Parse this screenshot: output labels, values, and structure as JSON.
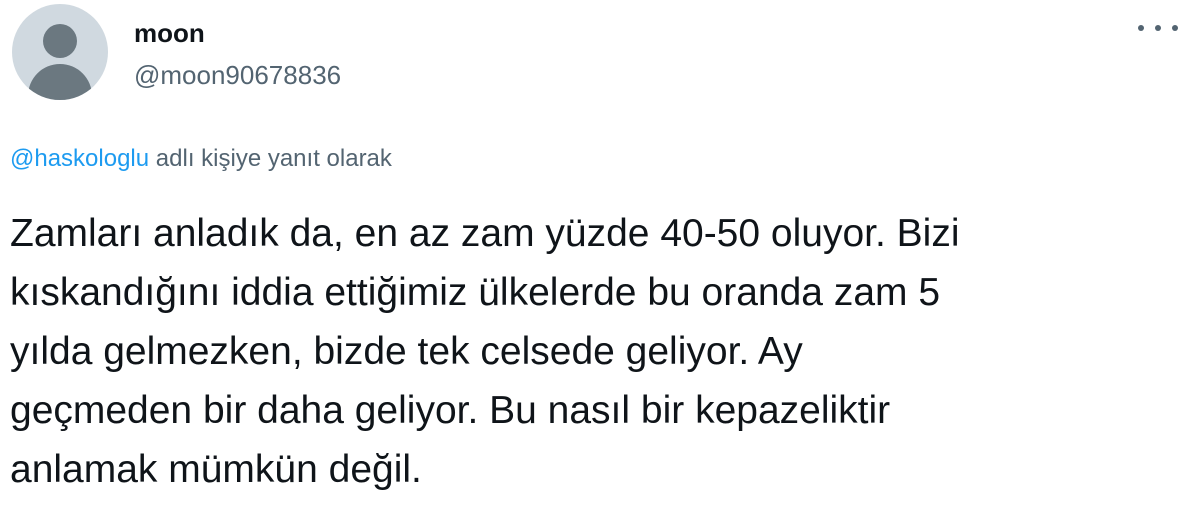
{
  "user": {
    "display_name": "moon",
    "handle": "@moon90678836",
    "avatar_icon": "default-profile-icon"
  },
  "reply": {
    "mention": "@haskologlu",
    "suffix": " adlı kişiye yanıt olarak"
  },
  "tweet": {
    "text_lines": [
      "Zamları anladık da, en az zam yüzde 40-50 oluyor. Bizi",
      "kıskandığını iddia ettiğimiz ülkelerde bu oranda zam 5",
      "yılda gelmezken, bizde tek celsede geliyor. Ay",
      "geçmeden bir daha geliyor. Bu nasıl bir kepazeliktir",
      "anlamak mümkün değil."
    ]
  },
  "icons": {
    "more": "more-horizontal-icon"
  },
  "colors": {
    "text": "#0f1419",
    "secondary": "#536471",
    "link": "#1d9bf0",
    "avatar_bg": "#d0d9e0",
    "avatar_fg": "#6b7880"
  }
}
